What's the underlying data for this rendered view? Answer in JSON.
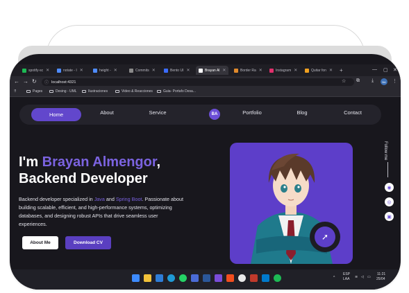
{
  "browser": {
    "tabs": [
      {
        "label": "spotify-sc",
        "color": "#1db954"
      },
      {
        "label": "notate - I",
        "color": "#4f8cff"
      },
      {
        "label": "height - ",
        "color": "#4f8cff"
      },
      {
        "label": "Commits",
        "color": "#8a8a8a"
      },
      {
        "label": "Bento UI",
        "color": "#3b6cff"
      },
      {
        "label": "Brayan Al",
        "color": "#ffffff",
        "active": true
      },
      {
        "label": "Border Ra",
        "color": "#e08a2c"
      },
      {
        "label": "Instagram",
        "color": "#e1306c"
      },
      {
        "label": "Quitar fon",
        "color": "#f0a020"
      }
    ],
    "url": "localhost:4321",
    "profile": "BA",
    "bookmarks": [
      "Pages",
      "Desing - UML",
      "Ilustraciones",
      "Video & Reacciones",
      "Guia- Portafo Desa..."
    ]
  },
  "nav": {
    "home": "Home",
    "about": "About",
    "service": "Service",
    "logo": "BA",
    "portfolio": "Portfolio",
    "blog": "Blog",
    "contact": "Contact"
  },
  "hero": {
    "greeting": "I'm ",
    "name": "Brayan Almengor",
    "comma": ",",
    "role": "Backend Developer",
    "desc_1": "Backend developer specialized in ",
    "java": "Java",
    "and": " and ",
    "spring": "Spring Boot",
    "desc_2": ". Passionate about building scalable, efficient, and high-performance systems, optimizing databases, and designing robust APIs that drive seamless user experiences.",
    "about_btn": "About Me",
    "cv_btn": "Download CV"
  },
  "follow": "Follow me",
  "socials": [
    "github-icon",
    "instagram-icon",
    "linkedin-icon"
  ],
  "taskbar": {
    "lang_top": "ESP",
    "lang_bottom": "LAA",
    "time": "11:21",
    "date": "25/04"
  },
  "colors": {
    "accent": "#6247cc",
    "background": "#18171d"
  }
}
